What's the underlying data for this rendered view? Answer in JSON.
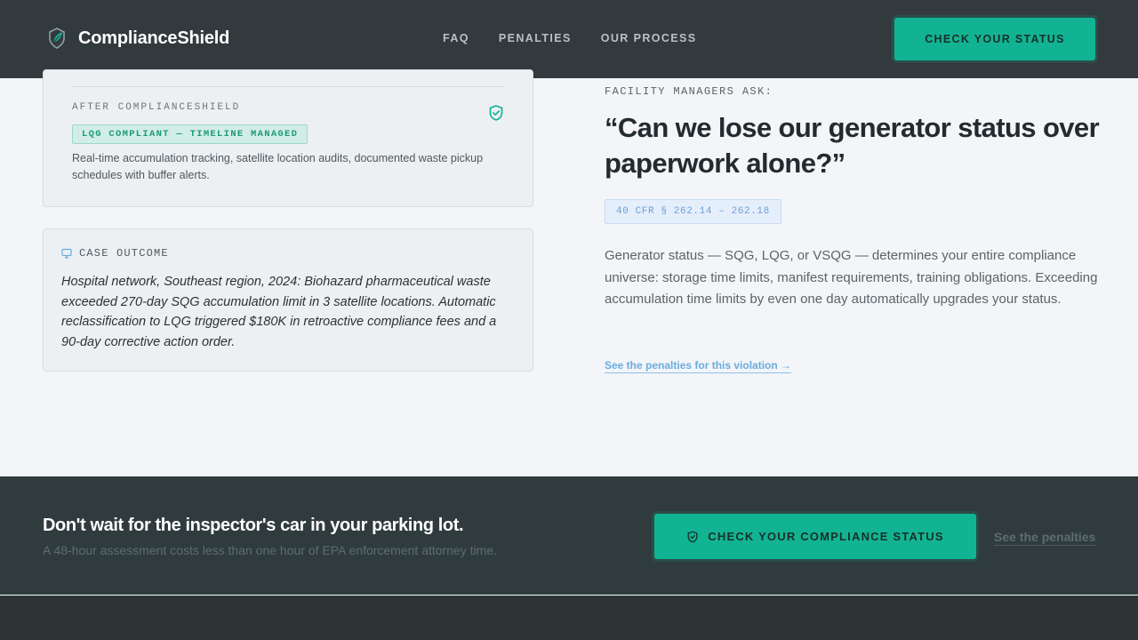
{
  "colors": {
    "nav_bg": "#323a3d",
    "accent": "#12b393",
    "page_bg": "#f3f5f8",
    "cta_band_bg": "#2f3b3d",
    "link_blue": "#6aace0"
  },
  "nav": {
    "brand_icon": "leaf-shield-icon",
    "brand_name": "ComplianceShield",
    "links": [
      "FAQ",
      "PENALTIES",
      "OUR PROCESS"
    ],
    "cta_label": "CHECK YOUR STATUS"
  },
  "after_card": {
    "label": "AFTER COMPLIANCESHIELD",
    "icon": "shield-check-icon",
    "badge": "LQG COMPLIANT — TIMELINE MANAGED",
    "description": "Real-time accumulation tracking, satellite location audits, documented waste pickup schedules with buffer alerts."
  },
  "case_card": {
    "icon": "monitor-icon",
    "label": "CASE OUTCOME",
    "text": "Hospital network, Southeast region, 2024: Biohazard pharmaceutical waste exceeded 270-day SQG accumulation limit in 3 satellite locations. Automatic reclassification to LQG triggered $180K in retroactive compliance fees and a 90-day corrective action order."
  },
  "faq": {
    "eyebrow": "FACILITY MANAGERS ASK:",
    "question": "“Can we lose our generator status over paperwork alone?”",
    "citation": "40 CFR § 262.14 – 262.18",
    "answer": "Generator status — SQG, LQG, or VSQG — determines your entire compliance universe: storage time limits, manifest requirements, training obligations. Exceeding accumulation time limits by even one day automatically upgrades your status.",
    "link": "See the penalties for this violation →"
  },
  "cta": {
    "title": "Don't wait for the inspector's car in your parking lot.",
    "subtitle": "A 48-hour assessment costs less than one hour of EPA enforcement attorney time.",
    "button_icon": "shield-icon",
    "button_label": "CHECK YOUR COMPLIANCE STATUS",
    "secondary_link": "See the penalties"
  }
}
